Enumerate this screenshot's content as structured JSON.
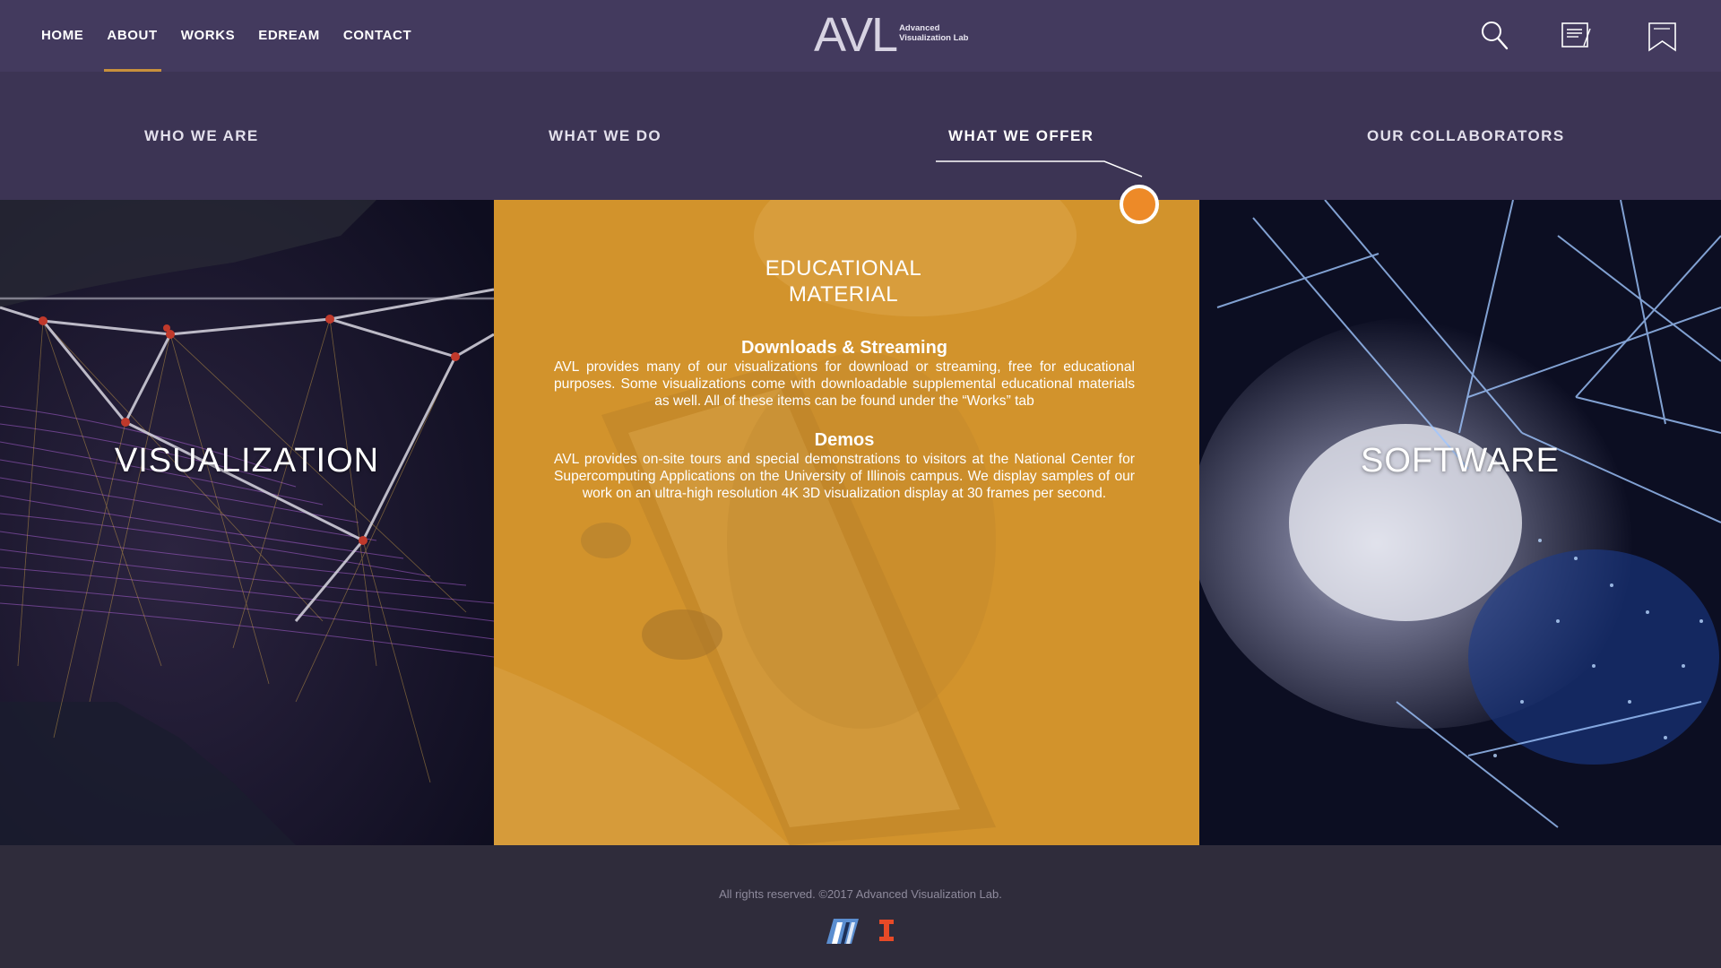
{
  "header": {
    "nav": [
      {
        "label": "HOME",
        "name": "nav-home"
      },
      {
        "label": "ABOUT",
        "name": "nav-about",
        "active": true
      },
      {
        "label": "WORKS",
        "name": "nav-works"
      },
      {
        "label": "EDREAM",
        "name": "nav-edream"
      },
      {
        "label": "CONTACT",
        "name": "nav-contact"
      }
    ],
    "logo": {
      "mark": "AVL",
      "line1": "Advanced",
      "line2": "Visualization Lab"
    },
    "icons": [
      "search-icon",
      "notepad-icon",
      "bookmark-icon"
    ]
  },
  "subnav": {
    "tabs": [
      {
        "label": "WHO WE ARE"
      },
      {
        "label": "WHAT WE DO"
      },
      {
        "label": "WHAT WE OFFER",
        "active": true
      },
      {
        "label": "OUR COLLABORATORS"
      }
    ]
  },
  "panels": {
    "left": {
      "title": "VISUALIZATION"
    },
    "middle": {
      "title_line1": "EDUCATIONAL",
      "title_line2": "MATERIAL",
      "sections": [
        {
          "heading": "Downloads & Streaming",
          "body": "AVL provides many of our visualizations for download or streaming, free for educational purposes. Some visualizations come with downloadable supplemental educational materials as well. All of these items can be found under the “Works” tab"
        },
        {
          "heading": "Demos",
          "body": "AVL provides on-site tours and special demonstrations to visitors at the National Center for Supercomputing Applications on the University of Illinois campus. We display samples of our work on an ultra-high resolution 4K 3D visualization display at 30 frames per second."
        }
      ]
    },
    "right": {
      "title": "SOFTWARE"
    }
  },
  "footer": {
    "copyright": "All rights reserved. ©2017 Advanced Visualization Lab.",
    "logos": [
      "ncsa-logo",
      "illinois-logo"
    ]
  },
  "colors": {
    "header_bg": "#433a5e",
    "subnav_bg": "#3c3454",
    "accent": "#c8903c",
    "indicator": "#ed8a28",
    "panel_mid": "#d2932c",
    "footer_bg": "#2f2c3b"
  }
}
